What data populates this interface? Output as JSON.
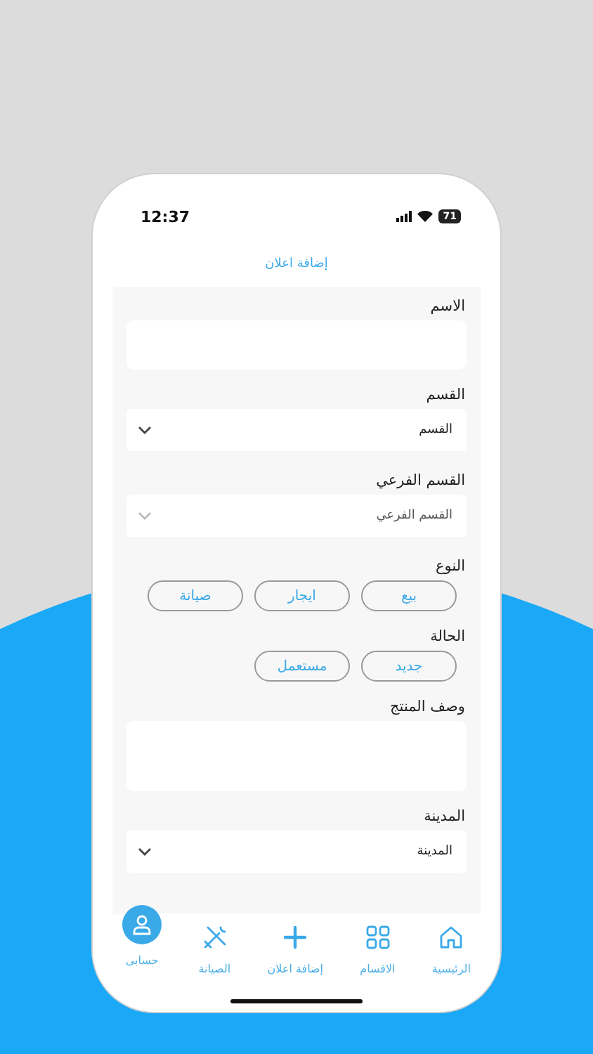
{
  "status_bar": {
    "time": "12:37",
    "battery": "71"
  },
  "header": {
    "title": "إضافة اعلان"
  },
  "form": {
    "fields": [
      {
        "kind": "text",
        "label": "الاسم"
      },
      {
        "kind": "select",
        "label": "القسم",
        "value": "القسم",
        "disabled": false
      },
      {
        "kind": "select",
        "label": "القسم الفرعي",
        "value": "القسم الفرعي",
        "disabled": true
      },
      {
        "kind": "chips",
        "label": "النوع",
        "options": [
          "بيع",
          "ايجار",
          "صيانة"
        ]
      },
      {
        "kind": "chips",
        "label": "الحالة",
        "options": [
          "جديد",
          "مستعمل"
        ]
      },
      {
        "kind": "textarea",
        "label": "وصف المنتج"
      },
      {
        "kind": "select",
        "label": "المدينة",
        "value": "المدينة",
        "disabled": false
      }
    ]
  },
  "bottom_nav": [
    {
      "kind": "home",
      "label": "الرئيسية"
    },
    {
      "kind": "grid",
      "label": "الاقسام"
    },
    {
      "kind": "plus",
      "label": "إضافة اعلان"
    },
    {
      "kind": "tools",
      "label": "الصيانة"
    },
    {
      "kind": "user",
      "label": "حسابى"
    }
  ]
}
